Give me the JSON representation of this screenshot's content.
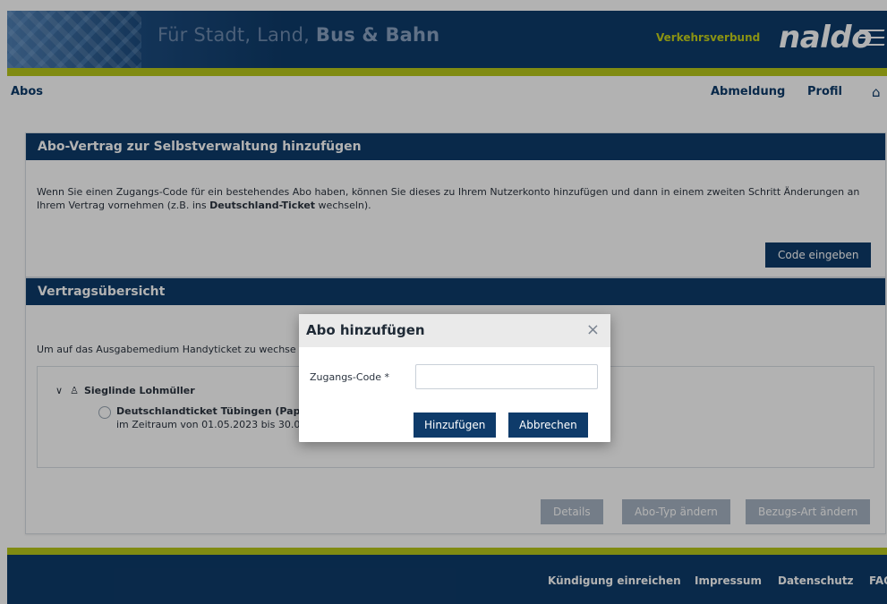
{
  "header": {
    "slogan_normal": "Für Stadt, Land, ",
    "slogan_bold": "Bus & Bahn",
    "brand_small": "Verkehrsverbund",
    "brand_logo": "naldo"
  },
  "nav": {
    "section": "Abos",
    "logout": "Abmeldung",
    "profile": "Profil",
    "home_icon": "⌂"
  },
  "card_add": {
    "title": "Abo-Vertrag zur Selbstverwaltung hinzufügen",
    "text_before": "Wenn Sie einen Zugangs-Code für ein bestehendes Abo haben, können Sie dieses zu Ihrem Nutzerkonto hinzufügen und dann in einem zweiten Schritt Änderungen an Ihrem Vertrag vornehmen (z.B. ins ",
    "text_bold": "Deutschland-Ticket",
    "text_after": " wechseln).",
    "button": "Code eingeben"
  },
  "card_overview": {
    "title": "Vertragsübersicht",
    "intro": "Um auf das Ausgabemedium Handyticket zu wechse",
    "user_chevron": "∨",
    "user_icon": "♙",
    "user_name": "Sieglinde Lohmüller",
    "ticket_name": "Deutschlandticket Tübingen (Papi",
    "ticket_range": "im Zeitraum von 01.05.2023 bis 30.0",
    "buttons": {
      "details": "Details",
      "change_type": "Abo-Typ ändern",
      "change_delivery": "Bezugs-Art ändern"
    }
  },
  "footer": {
    "links": [
      "Kündigung einreichen",
      "Impressum",
      "Datenschutz",
      "FAQ"
    ]
  },
  "modal": {
    "title": "Abo hinzufügen",
    "close": "×",
    "field_label": "Zugangs-Code *",
    "field_value": "",
    "field_placeholder": "",
    "add_button": "Hinzufügen",
    "cancel_button": "Abbrechen"
  },
  "colors": {
    "navy": "#0e3b6a",
    "lime": "#b8c71a",
    "gray_button": "#a7b4c3"
  }
}
